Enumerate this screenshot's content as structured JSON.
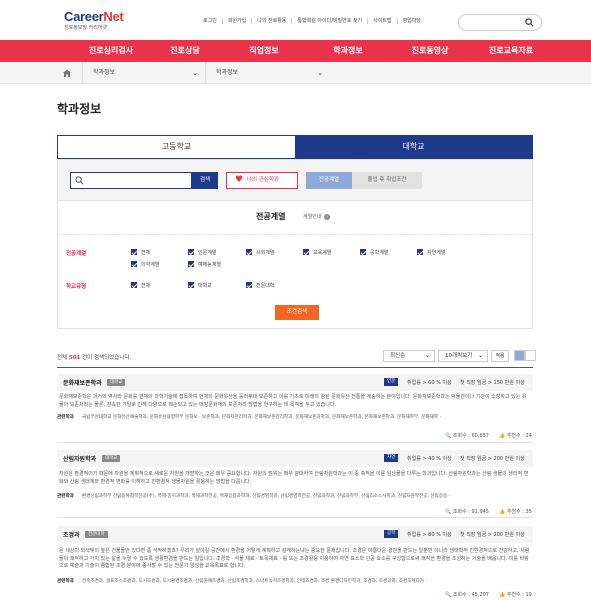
{
  "header": {
    "logo_main": "Career",
    "logo_net": "Net",
    "logo_sub": "진로정보망 커리어넷",
    "topnav": [
      "로그인",
      "회원가입",
      "나의 진로활동",
      "통합회원 아이디/비밀번호 찾기",
      "사이트맵",
      "영업마당"
    ]
  },
  "mainnav": [
    "진로심리검사",
    "진로상담",
    "직업정보",
    "학과정보",
    "진로동영상",
    "진로교육자료"
  ],
  "breadcrumb": [
    "학과정보",
    "학과정보"
  ],
  "page_title": "학과정보",
  "school_tabs": [
    "고등학교",
    "대학교"
  ],
  "search": {
    "button": "검색",
    "interest_button": "나의 관심학과",
    "tab_field": "전공계열",
    "tab_job": "졸업 후 취업조건"
  },
  "filter": {
    "title": "전공계열",
    "guide": "계열안내",
    "field_label": "전공계열",
    "field_options": [
      "전체",
      "인문계열",
      "사회계열",
      "교육계열",
      "공학계열",
      "자연계열",
      "의약계열",
      "예체능계열"
    ],
    "school_label": "학교유형",
    "school_options": [
      "전체",
      "대학교",
      "전문대학"
    ],
    "submit": "조건검색"
  },
  "results": {
    "count_prefix": "전체",
    "count": "501",
    "count_suffix": "건이 검색되었습니다.",
    "sort": "최신순",
    "per_page": "10개씩보기",
    "apply": "적용"
  },
  "cards": [
    {
      "name": "문화재보존학과",
      "badge": "대학교",
      "tag": "인문",
      "employment": "취업률 > 60 % 이상",
      "salary": "첫 직장 임금 > 150 만원 이상",
      "desc": "문화재보존학은 과거의 역사와 문화를 현재의 과학기술에 접목하여 현재의 문화유산을 흘러후대 보존하고 이를 기초로 미래의 참된 문화유산 전통을 계승하는 분야입니다. 문화재보존학과는 박물관이나 기관이 소장하고 있는 유물의 보존처리는 물론, 감속한 가탈로 인해 다양으로 훼손되고 있는 매장문화재의 보존처리 방법을 연구하는 데 목적을 두고 있습니다.",
      "rel_label": "관련학과",
      "rel": "국립부산대학교 문화유산예술학과, 문화유산융합학부 문화보 · 보존학과, 문화자관리학과, 문화재보존관리학과, 문화재보존과학과, 문화재보존학과, 문화재보존학과, 문화재학부, 문화재학 ·",
      "views": "조회수 : 60,657",
      "likes": "추천수 : 24"
    },
    {
      "name": "산림자원학과",
      "badge": "대학교",
      "tag": "자연",
      "employment": "취업률 > 40 % 이상",
      "salary": "첫 직장 임금 > 200 만원 이상",
      "desc": "자원은 환경적이기 때문에 자원을 계획적으로 새로운 자원을 개발하는 것은 매우 중요합니다. 자원의 범위는 매우 광대하여 산림자원학과는 이 중 축적을 이룬 임산물을 다루는 학과입니다. 산림자원학과는 산림 생물의 생리적 변화와 산림 생태계와 환경적 변화를 이해하고 친환경적 생물자원을 활용하는 방법을 다룹니다.",
      "rel_label": "관련학과",
      "rel": "환경산림과학부 산림융복합학전공(주), 목재·종이과학과, 목재과학전공, 목재응용과학과, 산림경영학과, 산림경영학전공, 산림과학과, 산림과학부, 산림리소스시학과, 산림자원학전공, 산림응용 ·",
      "views": "조회수 : 91,945",
      "likes": "추천수 : 35"
    },
    {
      "name": "조경과",
      "badge": "전문대학",
      "tag": "공학",
      "employment": "취업률 > 80 % 이상",
      "salary": "첫 직장 임금 > 200 만원 이상",
      "desc": "온 세상이 회색빛의 높은 건물들만 있다면 좀 삭막하겠죠? 우리가 살아갈 공간에서 환경을 어떻게 계획하고 설계하는냐는 중요한 문제입니다. 조경은 아름다운 경관을 만드는 일뿐만 아니라 생태학적 친환경적으로 건강하고, 사람들이 쾌적하고 가치 있는 삶을 누릴 수 있도록 생활환경을 만드는 일입니다. 조경학 · 식물 재료 · 토목재료 · 를 또는 조경활용 이용하여 자연 요소와 인공 요소를 구성함으로써 쾌적한 환경을 조성하는 기술을 배웁니다. 이를 바탕으로 예술과 기술이 종합된 조경 분야에 종사할 수 있는 전문가 양성을 교육목표로 합니다.",
      "rel_label": "관련학과",
      "rel": "건축조경과, 골프조스조경과, 도시조경과, 도시환경조경과, 산림원예조경과, 산림조경학과, 스마트녹지조경학과, 인테조경과, 조경 환경디자인학과, 조경과, 조경과와, 조경조제디가 ·",
      "views": "조회수 : 45,207",
      "likes": "추천수 : 19"
    }
  ],
  "colors": {
    "brand_red": "#e8334a",
    "brand_navy": "#1e3a8a",
    "accent_orange": "#f26522"
  }
}
